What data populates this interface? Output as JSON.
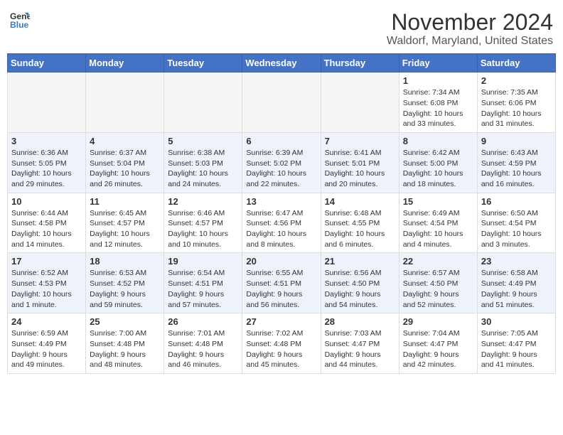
{
  "header": {
    "logo_general": "General",
    "logo_blue": "Blue",
    "title": "November 2024",
    "subtitle": "Waldorf, Maryland, United States"
  },
  "calendar": {
    "weekdays": [
      "Sunday",
      "Monday",
      "Tuesday",
      "Wednesday",
      "Thursday",
      "Friday",
      "Saturday"
    ],
    "weeks": [
      [
        {
          "day": "",
          "info": ""
        },
        {
          "day": "",
          "info": ""
        },
        {
          "day": "",
          "info": ""
        },
        {
          "day": "",
          "info": ""
        },
        {
          "day": "",
          "info": ""
        },
        {
          "day": "1",
          "info": "Sunrise: 7:34 AM\nSunset: 6:08 PM\nDaylight: 10 hours and 33 minutes."
        },
        {
          "day": "2",
          "info": "Sunrise: 7:35 AM\nSunset: 6:06 PM\nDaylight: 10 hours and 31 minutes."
        }
      ],
      [
        {
          "day": "3",
          "info": "Sunrise: 6:36 AM\nSunset: 5:05 PM\nDaylight: 10 hours and 29 minutes."
        },
        {
          "day": "4",
          "info": "Sunrise: 6:37 AM\nSunset: 5:04 PM\nDaylight: 10 hours and 26 minutes."
        },
        {
          "day": "5",
          "info": "Sunrise: 6:38 AM\nSunset: 5:03 PM\nDaylight: 10 hours and 24 minutes."
        },
        {
          "day": "6",
          "info": "Sunrise: 6:39 AM\nSunset: 5:02 PM\nDaylight: 10 hours and 22 minutes."
        },
        {
          "day": "7",
          "info": "Sunrise: 6:41 AM\nSunset: 5:01 PM\nDaylight: 10 hours and 20 minutes."
        },
        {
          "day": "8",
          "info": "Sunrise: 6:42 AM\nSunset: 5:00 PM\nDaylight: 10 hours and 18 minutes."
        },
        {
          "day": "9",
          "info": "Sunrise: 6:43 AM\nSunset: 4:59 PM\nDaylight: 10 hours and 16 minutes."
        }
      ],
      [
        {
          "day": "10",
          "info": "Sunrise: 6:44 AM\nSunset: 4:58 PM\nDaylight: 10 hours and 14 minutes."
        },
        {
          "day": "11",
          "info": "Sunrise: 6:45 AM\nSunset: 4:57 PM\nDaylight: 10 hours and 12 minutes."
        },
        {
          "day": "12",
          "info": "Sunrise: 6:46 AM\nSunset: 4:57 PM\nDaylight: 10 hours and 10 minutes."
        },
        {
          "day": "13",
          "info": "Sunrise: 6:47 AM\nSunset: 4:56 PM\nDaylight: 10 hours and 8 minutes."
        },
        {
          "day": "14",
          "info": "Sunrise: 6:48 AM\nSunset: 4:55 PM\nDaylight: 10 hours and 6 minutes."
        },
        {
          "day": "15",
          "info": "Sunrise: 6:49 AM\nSunset: 4:54 PM\nDaylight: 10 hours and 4 minutes."
        },
        {
          "day": "16",
          "info": "Sunrise: 6:50 AM\nSunset: 4:54 PM\nDaylight: 10 hours and 3 minutes."
        }
      ],
      [
        {
          "day": "17",
          "info": "Sunrise: 6:52 AM\nSunset: 4:53 PM\nDaylight: 10 hours and 1 minute."
        },
        {
          "day": "18",
          "info": "Sunrise: 6:53 AM\nSunset: 4:52 PM\nDaylight: 9 hours and 59 minutes."
        },
        {
          "day": "19",
          "info": "Sunrise: 6:54 AM\nSunset: 4:51 PM\nDaylight: 9 hours and 57 minutes."
        },
        {
          "day": "20",
          "info": "Sunrise: 6:55 AM\nSunset: 4:51 PM\nDaylight: 9 hours and 56 minutes."
        },
        {
          "day": "21",
          "info": "Sunrise: 6:56 AM\nSunset: 4:50 PM\nDaylight: 9 hours and 54 minutes."
        },
        {
          "day": "22",
          "info": "Sunrise: 6:57 AM\nSunset: 4:50 PM\nDaylight: 9 hours and 52 minutes."
        },
        {
          "day": "23",
          "info": "Sunrise: 6:58 AM\nSunset: 4:49 PM\nDaylight: 9 hours and 51 minutes."
        }
      ],
      [
        {
          "day": "24",
          "info": "Sunrise: 6:59 AM\nSunset: 4:49 PM\nDaylight: 9 hours and 49 minutes."
        },
        {
          "day": "25",
          "info": "Sunrise: 7:00 AM\nSunset: 4:48 PM\nDaylight: 9 hours and 48 minutes."
        },
        {
          "day": "26",
          "info": "Sunrise: 7:01 AM\nSunset: 4:48 PM\nDaylight: 9 hours and 46 minutes."
        },
        {
          "day": "27",
          "info": "Sunrise: 7:02 AM\nSunset: 4:48 PM\nDaylight: 9 hours and 45 minutes."
        },
        {
          "day": "28",
          "info": "Sunrise: 7:03 AM\nSunset: 4:47 PM\nDaylight: 9 hours and 44 minutes."
        },
        {
          "day": "29",
          "info": "Sunrise: 7:04 AM\nSunset: 4:47 PM\nDaylight: 9 hours and 42 minutes."
        },
        {
          "day": "30",
          "info": "Sunrise: 7:05 AM\nSunset: 4:47 PM\nDaylight: 9 hours and 41 minutes."
        }
      ]
    ]
  }
}
